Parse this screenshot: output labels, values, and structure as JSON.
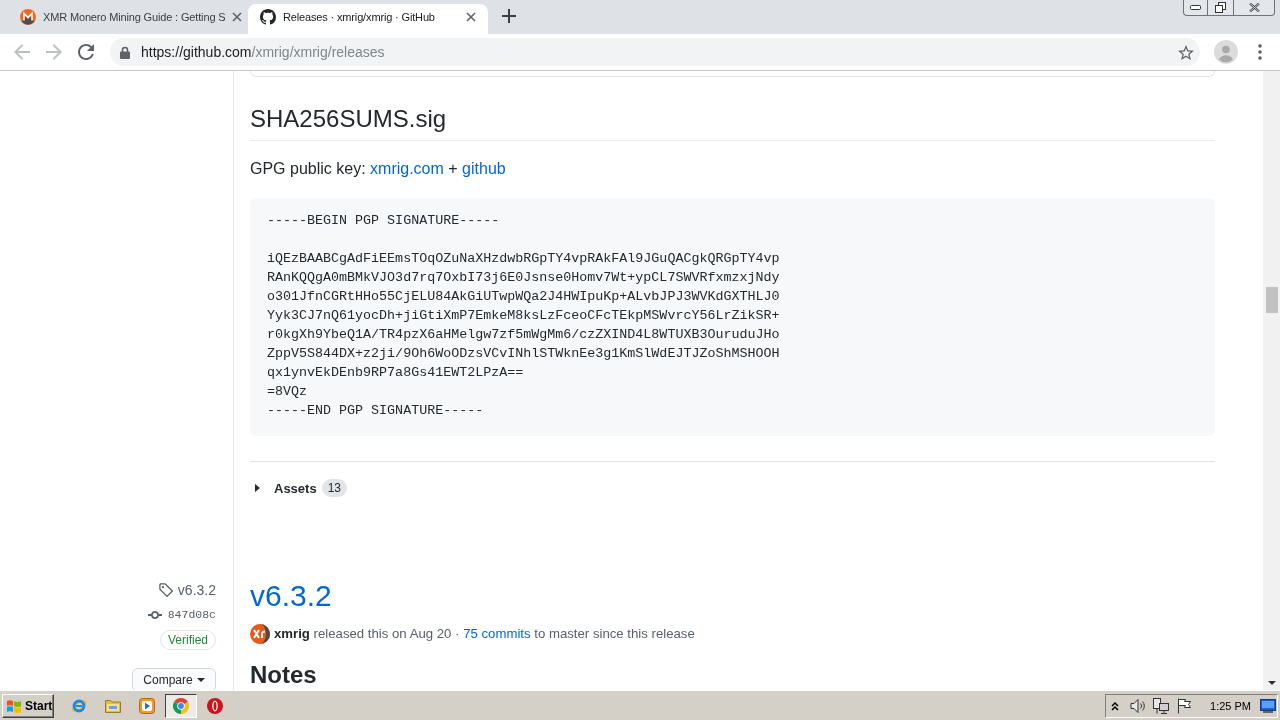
{
  "browser": {
    "tabs": [
      {
        "kind": "monero",
        "title": "XMR Monero Mining Guide : Getting S",
        "selected": false
      },
      {
        "kind": "github",
        "title": "Releases · xmrig/xmrig · GitHub",
        "selected": true
      }
    ],
    "navigation": {
      "back": {
        "disabled": true
      },
      "forward": {
        "disabled": true
      }
    },
    "address": {
      "scheme": "https://",
      "host": "github.com",
      "path": "/xmrig/xmrig/releases"
    }
  },
  "release": {
    "heading": "SHA256SUMS.sig",
    "gpg_key": [
      {
        "kind": "text",
        "text": "GPG public key:"
      },
      {
        "kind": "link",
        "text": "xmrig.com"
      },
      {
        "kind": "text",
        "text": "+"
      },
      {
        "kind": "link",
        "text": "github"
      }
    ],
    "signature": {
      "begin": "-----BEGIN PGP SIGNATURE-----",
      "lines": [
        "iQEzBAABCgAdFiEEmsTOqOZuNaXHzdwbRGpTY4vpRAkFAl9JGuQACgkQRGpTY4vp",
        "RAnKQQgA0mBMkVJO3d7rq7OxbI73j6E0Jsnse0Homv7Wt+ypCL7SWVRfxmzxjNdy",
        "o301JfnCGRtHHo55CjELU84AkGiUTwpWQa2J4HWIpuKp+ALvbJPJ3WVKdGXTHLJ0",
        "Yyk3CJ7nQ61yocDh+jiGtiXmP7EmkeM8ksLzFceoCFcTEkpMSWvrcY56LrZikSR+",
        "r0kgXh9YbeQ1A/TR4pzX6aHMelgw7zf5mWgMm6/czZXIND4L8WTUXB3OuruduJHo",
        "ZppV5S844DX+z2ji/9Oh6WoODzsVCvINhlSTWknEe3g1KmSlWdEJTJZoShMSHOOH",
        "qx1ynvEkDEnb9RP7a8Gs41EWT2LPzA==",
        "=8VQz"
      ],
      "end": "-----END PGP SIGNATURE-----"
    },
    "assets": {
      "label": "Assets",
      "count": "13",
      "expanded": false
    }
  },
  "sidebar": {
    "tag": "v6.3.2",
    "commit": "847d08c",
    "verified": "Verified",
    "compare": "Compare"
  },
  "next_release": {
    "title": "v6.3.2",
    "meta": [
      {
        "kind": "author",
        "text": "xmrig"
      },
      {
        "kind": "text",
        "text": "released this on Aug 20 ·"
      },
      {
        "kind": "link",
        "text": "75 commits"
      },
      {
        "kind": "text",
        "text": "to master since this release"
      }
    ],
    "notes_heading": "Notes"
  },
  "taskbar": {
    "start": "Start",
    "apps": [
      {
        "kind": "ie",
        "selected": false
      },
      {
        "kind": "folder",
        "selected": false
      },
      {
        "kind": "media",
        "selected": false
      },
      {
        "kind": "chrome",
        "selected": true
      },
      {
        "kind": "opera",
        "selected": false
      }
    ],
    "clock": "1:25 PM"
  }
}
